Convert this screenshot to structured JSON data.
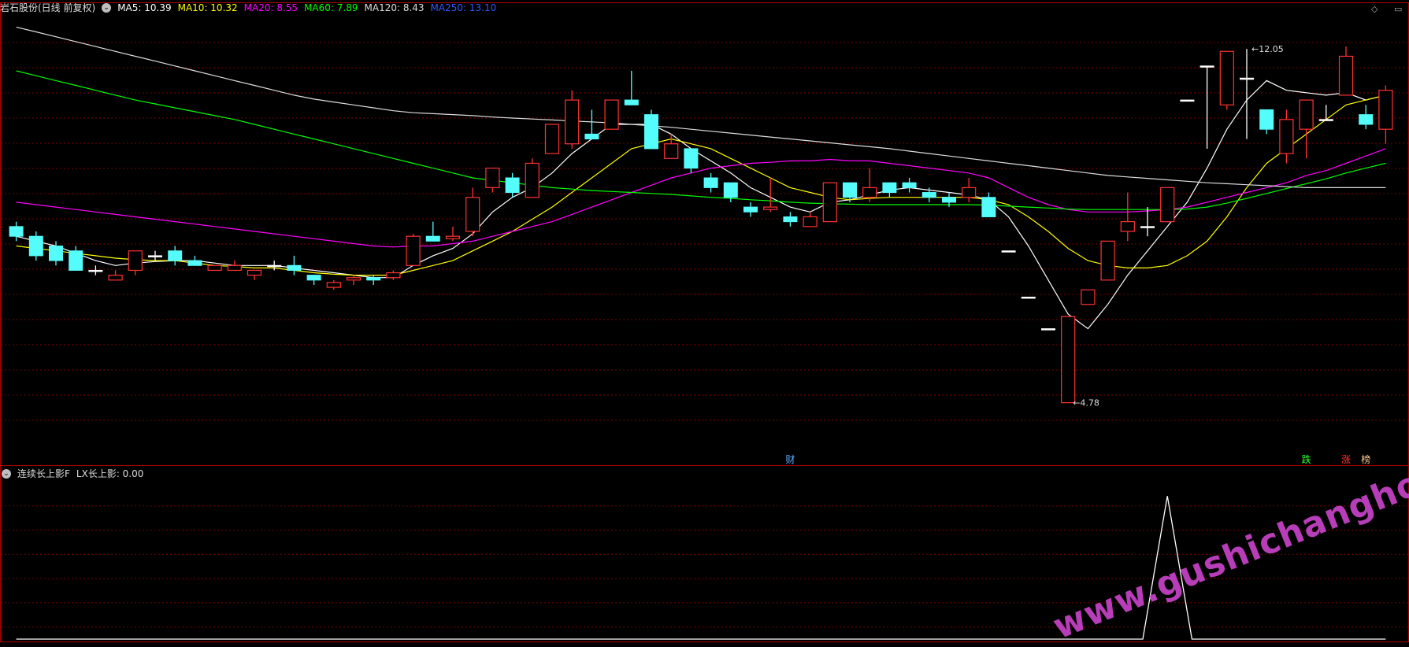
{
  "header": {
    "title": "岩石股份(日线 前复权)",
    "ma": [
      {
        "label": "MA5: 10.39",
        "color": "#ffffff"
      },
      {
        "label": "MA10: 10.32",
        "color": "#ffff00"
      },
      {
        "label": "MA20: 8.55",
        "color": "#ff00ff"
      },
      {
        "label": "MA60: 7.89",
        "color": "#00ff00"
      },
      {
        "label": "MA120: 8.43",
        "color": "#dddddd"
      },
      {
        "label": "MA250: 13.10",
        "color": "#2d5bff"
      }
    ]
  },
  "indicator": {
    "name": "连续长上影F",
    "value_label": "LX长上影: 0.00"
  },
  "colors": {
    "up": "#ff3232",
    "down": "#54fcfc",
    "grid": "#7a0000",
    "border": "#b00000",
    "bg": "#000000"
  },
  "watermark": "www.gushichanghong.com",
  "chart_data": [
    {
      "type": "candlestick",
      "title": "岩石股份(日线 前复权)",
      "ylim": [
        3.9,
        12.7
      ],
      "candles": [
        [
          8.4,
          8.2,
          8.5,
          8.1
        ],
        [
          8.2,
          7.8,
          8.3,
          7.7
        ],
        [
          8.0,
          7.7,
          8.1,
          7.6
        ],
        [
          7.9,
          7.5,
          8.0,
          7.5
        ],
        [
          7.5,
          7.5,
          7.6,
          7.4
        ],
        [
          7.3,
          7.4,
          7.5,
          7.3
        ],
        [
          7.5,
          7.9,
          7.9,
          7.4
        ],
        [
          7.8,
          7.8,
          7.9,
          7.7
        ],
        [
          7.9,
          7.7,
          8.0,
          7.6
        ],
        [
          7.7,
          7.6,
          7.8,
          7.6
        ],
        [
          7.5,
          7.6,
          7.6,
          7.5
        ],
        [
          7.5,
          7.6,
          7.7,
          7.5
        ],
        [
          7.4,
          7.5,
          7.5,
          7.3
        ],
        [
          7.6,
          7.6,
          7.7,
          7.5
        ],
        [
          7.6,
          7.5,
          7.8,
          7.4
        ],
        [
          7.4,
          7.3,
          7.4,
          7.2
        ],
        [
          7.15,
          7.25,
          7.3,
          7.1
        ],
        [
          7.3,
          7.35,
          7.4,
          7.2
        ],
        [
          7.35,
          7.3,
          7.4,
          7.2
        ],
        [
          7.35,
          7.45,
          7.5,
          7.3
        ],
        [
          7.6,
          8.2,
          8.25,
          7.6
        ],
        [
          8.2,
          8.1,
          8.5,
          8.1
        ],
        [
          8.15,
          8.2,
          8.4,
          8.1
        ],
        [
          8.3,
          9.0,
          9.2,
          8.2
        ],
        [
          9.2,
          9.6,
          9.6,
          9.1
        ],
        [
          9.4,
          9.1,
          9.5,
          9.0
        ],
        [
          9.0,
          9.7,
          9.8,
          9.0
        ],
        [
          9.9,
          10.5,
          10.5,
          9.9
        ],
        [
          10.1,
          11.0,
          11.2,
          10.0
        ],
        [
          10.3,
          10.2,
          10.8,
          10.2
        ],
        [
          10.4,
          11.0,
          11.0,
          10.4
        ],
        [
          11.0,
          10.9,
          11.6,
          10.9
        ],
        [
          10.7,
          10.0,
          10.8,
          10.0
        ],
        [
          9.8,
          10.1,
          10.3,
          9.8
        ],
        [
          10.0,
          9.6,
          10.0,
          9.5
        ],
        [
          9.4,
          9.2,
          9.5,
          9.1
        ],
        [
          9.3,
          9.0,
          9.3,
          8.9
        ],
        [
          8.8,
          8.7,
          8.9,
          8.6
        ],
        [
          8.75,
          8.8,
          9.4,
          8.7
        ],
        [
          8.6,
          8.5,
          8.7,
          8.4
        ],
        [
          8.4,
          8.6,
          8.7,
          8.4
        ],
        [
          8.5,
          9.3,
          9.3,
          8.5
        ],
        [
          9.3,
          9.0,
          9.3,
          8.9
        ],
        [
          9.0,
          9.2,
          9.6,
          8.9
        ],
        [
          9.3,
          9.1,
          9.3,
          9.0
        ],
        [
          9.3,
          9.2,
          9.4,
          9.1
        ],
        [
          9.1,
          9.0,
          9.2,
          8.9
        ],
        [
          9.0,
          8.9,
          9.1,
          8.8
        ],
        [
          9.0,
          9.2,
          9.4,
          8.9
        ],
        [
          9.0,
          8.6,
          9.1,
          8.6
        ],
        [
          7.9,
          7.9,
          7.9,
          7.9
        ],
        [
          6.95,
          6.95,
          6.95,
          6.95
        ],
        [
          6.3,
          6.3,
          6.3,
          6.3
        ],
        [
          4.78,
          6.55,
          6.55,
          4.78
        ],
        [
          6.8,
          7.1,
          7.1,
          6.8
        ],
        [
          7.3,
          8.1,
          8.1,
          7.3
        ],
        [
          8.3,
          8.5,
          9.1,
          8.1
        ],
        [
          8.4,
          8.4,
          8.8,
          8.2
        ],
        [
          8.5,
          9.2,
          9.2,
          8.5
        ],
        [
          11.0,
          11.0,
          11.0,
          11.0
        ],
        [
          11.7,
          11.7,
          11.7,
          10.0
        ],
        [
          10.9,
          12.0,
          12.0,
          10.8
        ],
        [
          11.45,
          11.45,
          12.05,
          10.2
        ],
        [
          10.8,
          10.4,
          10.8,
          10.3
        ],
        [
          9.9,
          10.6,
          10.8,
          9.7
        ],
        [
          10.4,
          11.0,
          11.0,
          9.8
        ],
        [
          10.6,
          10.6,
          10.9,
          10.6
        ],
        [
          11.1,
          11.9,
          12.1,
          11.1
        ],
        [
          10.7,
          10.5,
          10.9,
          10.4
        ],
        [
          10.4,
          11.2,
          11.3,
          10.1
        ]
      ],
      "ma_series": [
        {
          "name": "MA5",
          "color": "#ffffff",
          "values": [
            8.2,
            8.1,
            8.0,
            7.85,
            7.7,
            7.6,
            7.65,
            7.68,
            7.7,
            7.7,
            7.65,
            7.6,
            7.6,
            7.6,
            7.55,
            7.5,
            7.45,
            7.4,
            7.35,
            7.35,
            7.6,
            7.8,
            7.95,
            8.25,
            8.7,
            9.0,
            9.2,
            9.5,
            9.9,
            10.2,
            10.5,
            10.5,
            10.5,
            10.3,
            10.0,
            9.75,
            9.5,
            9.2,
            9.0,
            8.8,
            8.7,
            8.9,
            8.95,
            9.05,
            9.15,
            9.2,
            9.15,
            9.1,
            9.05,
            8.95,
            8.6,
            8.0,
            7.3,
            6.6,
            6.3,
            6.8,
            7.4,
            7.9,
            8.4,
            8.9,
            9.6,
            10.4,
            11.0,
            11.4,
            11.2,
            11.15,
            11.1,
            11.15,
            11.0,
            11.1
          ]
        },
        {
          "name": "MA10",
          "color": "#ffff00",
          "values": [
            8.0,
            7.95,
            7.9,
            7.85,
            7.8,
            7.75,
            7.72,
            7.7,
            7.7,
            7.65,
            7.6,
            7.58,
            7.55,
            7.55,
            7.5,
            7.45,
            7.42,
            7.4,
            7.4,
            7.4,
            7.5,
            7.6,
            7.7,
            7.9,
            8.1,
            8.3,
            8.55,
            8.8,
            9.1,
            9.4,
            9.7,
            10.0,
            10.1,
            10.2,
            10.1,
            10.0,
            9.8,
            9.6,
            9.4,
            9.2,
            9.1,
            9.0,
            8.95,
            8.98,
            9.0,
            9.0,
            9.0,
            9.0,
            9.0,
            8.95,
            8.85,
            8.6,
            8.3,
            7.95,
            7.7,
            7.6,
            7.55,
            7.55,
            7.6,
            7.8,
            8.1,
            8.6,
            9.2,
            9.7,
            10.0,
            10.3,
            10.6,
            10.9,
            11.0,
            11.1
          ]
        },
        {
          "name": "MA20",
          "color": "#ff00ff",
          "values": [
            8.9,
            8.85,
            8.8,
            8.75,
            8.7,
            8.65,
            8.6,
            8.55,
            8.5,
            8.45,
            8.4,
            8.35,
            8.3,
            8.25,
            8.2,
            8.15,
            8.1,
            8.05,
            8.0,
            7.98,
            8.0,
            8.0,
            8.05,
            8.1,
            8.2,
            8.3,
            8.4,
            8.5,
            8.65,
            8.8,
            8.95,
            9.1,
            9.25,
            9.4,
            9.5,
            9.6,
            9.65,
            9.7,
            9.72,
            9.75,
            9.75,
            9.78,
            9.75,
            9.75,
            9.7,
            9.65,
            9.6,
            9.55,
            9.5,
            9.4,
            9.2,
            9.0,
            8.85,
            8.75,
            8.7,
            8.7,
            8.7,
            8.72,
            8.75,
            8.8,
            8.9,
            9.0,
            9.1,
            9.2,
            9.3,
            9.45,
            9.55,
            9.7,
            9.85,
            10.0
          ]
        },
        {
          "name": "MA60",
          "color": "#00ff00",
          "values": [
            11.6,
            11.5,
            11.4,
            11.3,
            11.2,
            11.1,
            11.0,
            10.92,
            10.84,
            10.76,
            10.68,
            10.6,
            10.5,
            10.4,
            10.3,
            10.2,
            10.1,
            10.0,
            9.9,
            9.8,
            9.7,
            9.6,
            9.5,
            9.4,
            9.35,
            9.3,
            9.25,
            9.2,
            9.17,
            9.14,
            9.12,
            9.1,
            9.08,
            9.06,
            9.03,
            9.0,
            8.98,
            8.95,
            8.93,
            8.9,
            8.88,
            8.87,
            8.86,
            8.85,
            8.85,
            8.85,
            8.85,
            8.85,
            8.85,
            8.84,
            8.82,
            8.8,
            8.78,
            8.76,
            8.75,
            8.75,
            8.75,
            8.75,
            8.75,
            8.76,
            8.8,
            8.88,
            8.98,
            9.08,
            9.18,
            9.28,
            9.38,
            9.5,
            9.6,
            9.7
          ]
        },
        {
          "name": "MA120",
          "color": "#dddddd",
          "values": [
            12.5,
            12.4,
            12.3,
            12.2,
            12.1,
            12.0,
            11.9,
            11.8,
            11.7,
            11.6,
            11.5,
            11.4,
            11.3,
            11.2,
            11.1,
            11.02,
            10.96,
            10.9,
            10.84,
            10.78,
            10.74,
            10.72,
            10.7,
            10.68,
            10.65,
            10.63,
            10.61,
            10.59,
            10.57,
            10.55,
            10.53,
            10.5,
            10.47,
            10.44,
            10.4,
            10.36,
            10.32,
            10.28,
            10.24,
            10.2,
            10.16,
            10.12,
            10.08,
            10.04,
            10.0,
            9.95,
            9.9,
            9.85,
            9.8,
            9.75,
            9.7,
            9.65,
            9.6,
            9.55,
            9.5,
            9.45,
            9.42,
            9.39,
            9.36,
            9.33,
            9.3,
            9.28,
            9.26,
            9.24,
            9.22,
            9.2,
            9.2,
            9.2,
            9.2,
            9.2
          ]
        }
      ],
      "annotations": [
        {
          "label": "12.05",
          "index": 62,
          "value": 12.05
        },
        {
          "label": "4.78",
          "index": 53,
          "value": 4.78
        }
      ],
      "bottom_marks": [
        {
          "label": "财",
          "index": 39,
          "color": "#5bb0ff"
        },
        {
          "label": "跌",
          "index": 65,
          "color": "#33ff33"
        },
        {
          "label": "涨",
          "index": 67,
          "color": "#ff3333"
        },
        {
          "label": "榜",
          "index": 68,
          "color": "#ffcc99"
        }
      ]
    },
    {
      "type": "line",
      "title": "连续长上影F",
      "series": [
        {
          "name": "LX长上影",
          "values": [
            0,
            0,
            0,
            0,
            0,
            0,
            0,
            0,
            0,
            0,
            0,
            0,
            0,
            0,
            0,
            0,
            0,
            0,
            0,
            0,
            0,
            0,
            0,
            0,
            0,
            0,
            0,
            0,
            0,
            0,
            0,
            0,
            0,
            0,
            0,
            0,
            0,
            0,
            0,
            0,
            0,
            0,
            0,
            0,
            0,
            0,
            0,
            0,
            0,
            0,
            0,
            0,
            0,
            0,
            0,
            0,
            0,
            0,
            1,
            0,
            0,
            0,
            0,
            0,
            0,
            0,
            0,
            0,
            0,
            0
          ]
        }
      ],
      "ylim": [
        0,
        1.1
      ]
    }
  ]
}
